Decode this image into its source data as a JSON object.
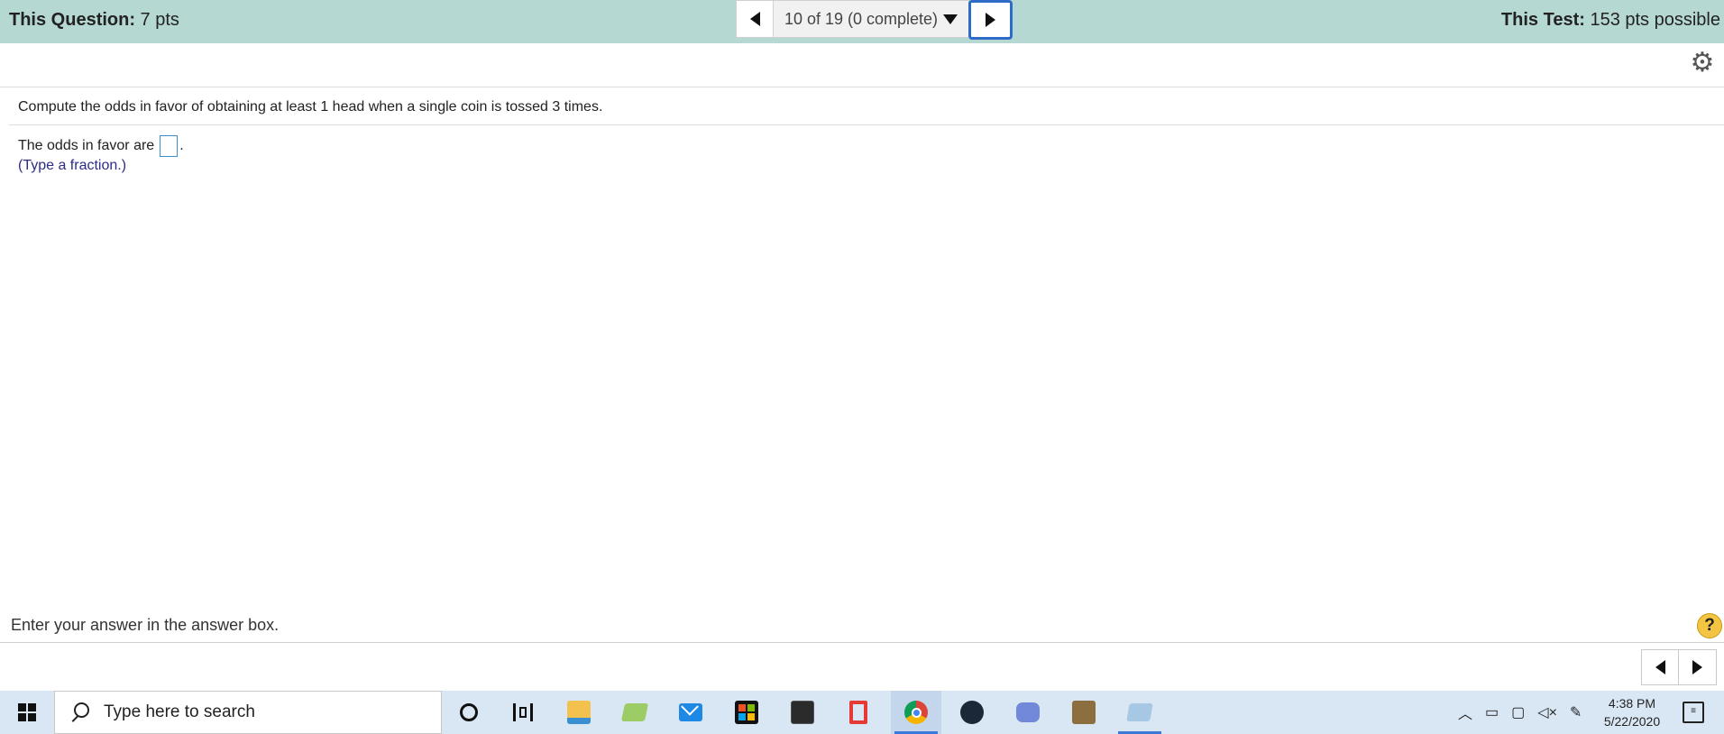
{
  "header": {
    "question_label": "This Question:",
    "question_value": " 7 pts",
    "test_label": "This Test:",
    "test_value": " 153 pts possible",
    "progress": "10 of 19 (0 complete)"
  },
  "question": {
    "prompt": "Compute the odds in favor of obtaining at least 1 head when a single coin is tossed 3 times.",
    "answer_prefix": "The odds in favor are",
    "answer_suffix": ".",
    "answer_value": "",
    "hint": "(Type a fraction.)"
  },
  "footer": {
    "instruction": "Enter your answer in the answer box.",
    "help": "?"
  },
  "taskbar": {
    "search_placeholder": "Type here to search",
    "time": "4:38 PM",
    "date": "5/22/2020",
    "apps": [
      {
        "icon": "cortana-icon"
      },
      {
        "icon": "task-view-icon"
      },
      {
        "icon": "file-explorer-icon",
        "color": "#f2c14e"
      },
      {
        "icon": "folder-green-icon",
        "color": "#8bc34a"
      },
      {
        "icon": "mail-icon",
        "color": "#1e88e5"
      },
      {
        "icon": "store-icon",
        "color": "#111111"
      },
      {
        "icon": "predator-icon",
        "color": "#2b2b2b"
      },
      {
        "icon": "office-icon",
        "color": "#e53935"
      },
      {
        "icon": "chrome-icon"
      },
      {
        "icon": "steam-icon",
        "color": "#1b2838"
      },
      {
        "icon": "discord-icon",
        "color": "#7289da"
      },
      {
        "icon": "game-icon",
        "color": "#8d6e3f"
      },
      {
        "icon": "notepad-icon",
        "color": "#7fb3d5"
      }
    ]
  },
  "colors": {
    "topbar": "#b6d8d3",
    "next_button_border": "#2f6cc7",
    "hint_text": "#2c2c8a",
    "taskbar": "#d9e6f4"
  }
}
